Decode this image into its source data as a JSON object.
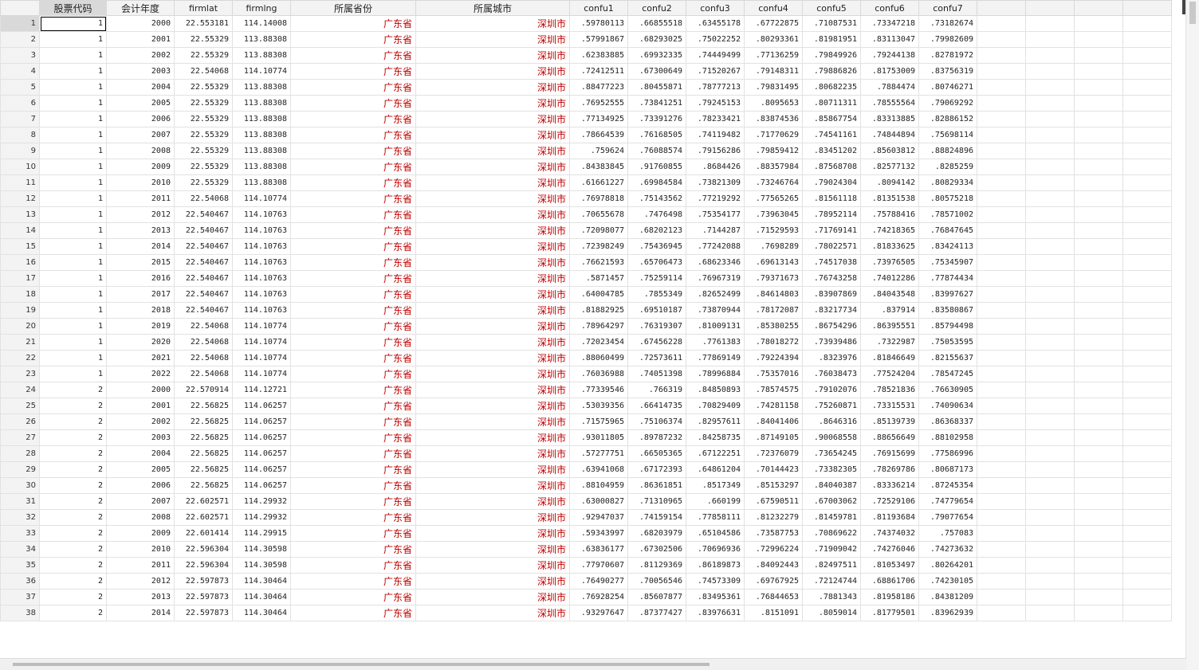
{
  "columns": [
    "股票代码",
    "会计年度",
    "firmlat",
    "firmlng",
    "所属省份",
    "所属城市",
    "confu1",
    "confu2",
    "confu3",
    "confu4",
    "confu5",
    "confu6",
    "confu7"
  ],
  "selected_column": "股票代码",
  "active_cell": {
    "row": "1",
    "column": "股票代码"
  },
  "rows": [
    [
      "1",
      "1",
      "2000",
      "22.553181",
      "114.14008",
      "广东省",
      "深圳市",
      ".59780113",
      ".66855518",
      ".63455178",
      ".67722875",
      ".71087531",
      ".73347218",
      ".73182674"
    ],
    [
      "2",
      "1",
      "2001",
      "22.55329",
      "113.88308",
      "广东省",
      "深圳市",
      ".57991867",
      ".68293025",
      ".75022252",
      ".80293361",
      ".81981951",
      ".83113047",
      ".79982609"
    ],
    [
      "3",
      "1",
      "2002",
      "22.55329",
      "113.88308",
      "广东省",
      "深圳市",
      ".62383885",
      ".69932335",
      ".74449499",
      ".77136259",
      ".79849926",
      ".79244138",
      ".82781972"
    ],
    [
      "4",
      "1",
      "2003",
      "22.54068",
      "114.10774",
      "广东省",
      "深圳市",
      ".72412511",
      ".67300649",
      ".71520267",
      ".79148311",
      ".79886826",
      ".81753009",
      ".83756319"
    ],
    [
      "5",
      "1",
      "2004",
      "22.55329",
      "113.88308",
      "广东省",
      "深圳市",
      ".88477223",
      ".80455871",
      ".78777213",
      ".79831495",
      ".80682235",
      ".7884474",
      ".80746271"
    ],
    [
      "6",
      "1",
      "2005",
      "22.55329",
      "113.88308",
      "广东省",
      "深圳市",
      ".76952555",
      ".73841251",
      ".79245153",
      ".8095653",
      ".80711311",
      ".78555564",
      ".79069292"
    ],
    [
      "7",
      "1",
      "2006",
      "22.55329",
      "113.88308",
      "广东省",
      "深圳市",
      ".77134925",
      ".73391276",
      ".78233421",
      ".83874536",
      ".85867754",
      ".83313885",
      ".82886152"
    ],
    [
      "8",
      "1",
      "2007",
      "22.55329",
      "113.88308",
      "广东省",
      "深圳市",
      ".78664539",
      ".76168505",
      ".74119482",
      ".71770629",
      ".74541161",
      ".74844894",
      ".75698114"
    ],
    [
      "9",
      "1",
      "2008",
      "22.55329",
      "113.88308",
      "广东省",
      "深圳市",
      ".759624",
      ".76088574",
      ".79156286",
      ".79859412",
      ".83451202",
      ".85603812",
      ".88824896"
    ],
    [
      "10",
      "1",
      "2009",
      "22.55329",
      "113.88308",
      "广东省",
      "深圳市",
      ".84383845",
      ".91760855",
      ".8684426",
      ".88357984",
      ".87568708",
      ".82577132",
      ".8285259"
    ],
    [
      "11",
      "1",
      "2010",
      "22.55329",
      "113.88308",
      "广东省",
      "深圳市",
      ".61661227",
      ".69984584",
      ".73821309",
      ".73246764",
      ".79024304",
      ".8094142",
      ".80829334"
    ],
    [
      "12",
      "1",
      "2011",
      "22.54068",
      "114.10774",
      "广东省",
      "深圳市",
      ".76978818",
      ".75143562",
      ".77219292",
      ".77565265",
      ".81561118",
      ".81351538",
      ".80575218"
    ],
    [
      "13",
      "1",
      "2012",
      "22.540467",
      "114.10763",
      "广东省",
      "深圳市",
      ".70655678",
      ".7476498",
      ".75354177",
      ".73963045",
      ".78952114",
      ".75788416",
      ".78571002"
    ],
    [
      "14",
      "1",
      "2013",
      "22.540467",
      "114.10763",
      "广东省",
      "深圳市",
      ".72098077",
      ".68202123",
      ".7144287",
      ".71529593",
      ".71769141",
      ".74218365",
      ".76847645"
    ],
    [
      "15",
      "1",
      "2014",
      "22.540467",
      "114.10763",
      "广东省",
      "深圳市",
      ".72398249",
      ".75436945",
      ".77242088",
      ".7698289",
      ".78022571",
      ".81833625",
      ".83424113"
    ],
    [
      "16",
      "1",
      "2015",
      "22.540467",
      "114.10763",
      "广东省",
      "深圳市",
      ".76621593",
      ".65706473",
      ".68623346",
      ".69613143",
      ".74517038",
      ".73976505",
      ".75345907"
    ],
    [
      "17",
      "1",
      "2016",
      "22.540467",
      "114.10763",
      "广东省",
      "深圳市",
      ".5871457",
      ".75259114",
      ".76967319",
      ".79371673",
      ".76743258",
      ".74012286",
      ".77874434"
    ],
    [
      "18",
      "1",
      "2017",
      "22.540467",
      "114.10763",
      "广东省",
      "深圳市",
      ".64004785",
      ".7855349",
      ".82652499",
      ".84614803",
      ".83907869",
      ".84043548",
      ".83997627"
    ],
    [
      "19",
      "1",
      "2018",
      "22.540467",
      "114.10763",
      "广东省",
      "深圳市",
      ".81882925",
      ".69510187",
      ".73870944",
      ".78172087",
      ".83217734",
      ".837914",
      ".83580867"
    ],
    [
      "20",
      "1",
      "2019",
      "22.54068",
      "114.10774",
      "广东省",
      "深圳市",
      ".78964297",
      ".76319307",
      ".81009131",
      ".85380255",
      ".86754296",
      ".86395551",
      ".85794498"
    ],
    [
      "21",
      "1",
      "2020",
      "22.54068",
      "114.10774",
      "广东省",
      "深圳市",
      ".72023454",
      ".67456228",
      ".7761383",
      ".78018272",
      ".73939486",
      ".7322987",
      ".75053595"
    ],
    [
      "22",
      "1",
      "2021",
      "22.54068",
      "114.10774",
      "广东省",
      "深圳市",
      ".88060499",
      ".72573611",
      ".77869149",
      ".79224394",
      ".8323976",
      ".81846649",
      ".82155637"
    ],
    [
      "23",
      "1",
      "2022",
      "22.54068",
      "114.10774",
      "广东省",
      "深圳市",
      ".76036988",
      ".74051398",
      ".78996884",
      ".75357016",
      ".76038473",
      ".77524204",
      ".78547245"
    ],
    [
      "24",
      "2",
      "2000",
      "22.570914",
      "114.12721",
      "广东省",
      "深圳市",
      ".77339546",
      ".766319",
      ".84850893",
      ".78574575",
      ".79102076",
      ".78521836",
      ".76630905"
    ],
    [
      "25",
      "2",
      "2001",
      "22.56825",
      "114.06257",
      "广东省",
      "深圳市",
      ".53039356",
      ".66414735",
      ".70829409",
      ".74281158",
      ".75260871",
      ".73315531",
      ".74090634"
    ],
    [
      "26",
      "2",
      "2002",
      "22.56825",
      "114.06257",
      "广东省",
      "深圳市",
      ".71575965",
      ".75106374",
      ".82957611",
      ".84041406",
      ".8646316",
      ".85139739",
      ".86368337"
    ],
    [
      "27",
      "2",
      "2003",
      "22.56825",
      "114.06257",
      "广东省",
      "深圳市",
      ".93011805",
      ".89787232",
      ".84258735",
      ".87149105",
      ".90068558",
      ".88656649",
      ".88102958"
    ],
    [
      "28",
      "2",
      "2004",
      "22.56825",
      "114.06257",
      "广东省",
      "深圳市",
      ".57277751",
      ".66505365",
      ".67122251",
      ".72376079",
      ".73654245",
      ".76915699",
      ".77586996"
    ],
    [
      "29",
      "2",
      "2005",
      "22.56825",
      "114.06257",
      "广东省",
      "深圳市",
      ".63941068",
      ".67172393",
      ".64861204",
      ".70144423",
      ".73382305",
      ".78269786",
      ".80687173"
    ],
    [
      "30",
      "2",
      "2006",
      "22.56825",
      "114.06257",
      "广东省",
      "深圳市",
      ".88104959",
      ".86361851",
      ".8517349",
      ".85153297",
      ".84040387",
      ".83336214",
      ".87245354"
    ],
    [
      "31",
      "2",
      "2007",
      "22.602571",
      "114.29932",
      "广东省",
      "深圳市",
      ".63000827",
      ".71310965",
      ".660199",
      ".67590511",
      ".67003062",
      ".72529106",
      ".74779654"
    ],
    [
      "32",
      "2",
      "2008",
      "22.602571",
      "114.29932",
      "广东省",
      "深圳市",
      ".92947037",
      ".74159154",
      ".77858111",
      ".81232279",
      ".81459781",
      ".81193684",
      ".79077654"
    ],
    [
      "33",
      "2",
      "2009",
      "22.601414",
      "114.29915",
      "广东省",
      "深圳市",
      ".59343997",
      ".68203979",
      ".65104586",
      ".73587753",
      ".70869622",
      ".74374032",
      ".757083"
    ],
    [
      "34",
      "2",
      "2010",
      "22.596304",
      "114.30598",
      "广东省",
      "深圳市",
      ".63836177",
      ".67302506",
      ".70696936",
      ".72996224",
      ".71909042",
      ".74276046",
      ".74273632"
    ],
    [
      "35",
      "2",
      "2011",
      "22.596304",
      "114.30598",
      "广东省",
      "深圳市",
      ".77970607",
      ".81129369",
      ".86189873",
      ".84092443",
      ".82497511",
      ".81053497",
      ".80264201"
    ],
    [
      "36",
      "2",
      "2012",
      "22.597873",
      "114.30464",
      "广东省",
      "深圳市",
      ".76490277",
      ".70056546",
      ".74573309",
      ".69767925",
      ".72124744",
      ".68861706",
      ".74230105"
    ],
    [
      "37",
      "2",
      "2013",
      "22.597873",
      "114.30464",
      "广东省",
      "深圳市",
      ".76928254",
      ".85607877",
      ".83495361",
      ".76844653",
      ".7881343",
      ".81958186",
      ".84381209"
    ],
    [
      "38",
      "2",
      "2014",
      "22.597873",
      "114.30464",
      "广东省",
      "深圳市",
      ".93297647",
      ".87377427",
      ".83976631",
      ".8151091",
      ".8059014",
      ".81779501",
      ".83962939"
    ]
  ]
}
